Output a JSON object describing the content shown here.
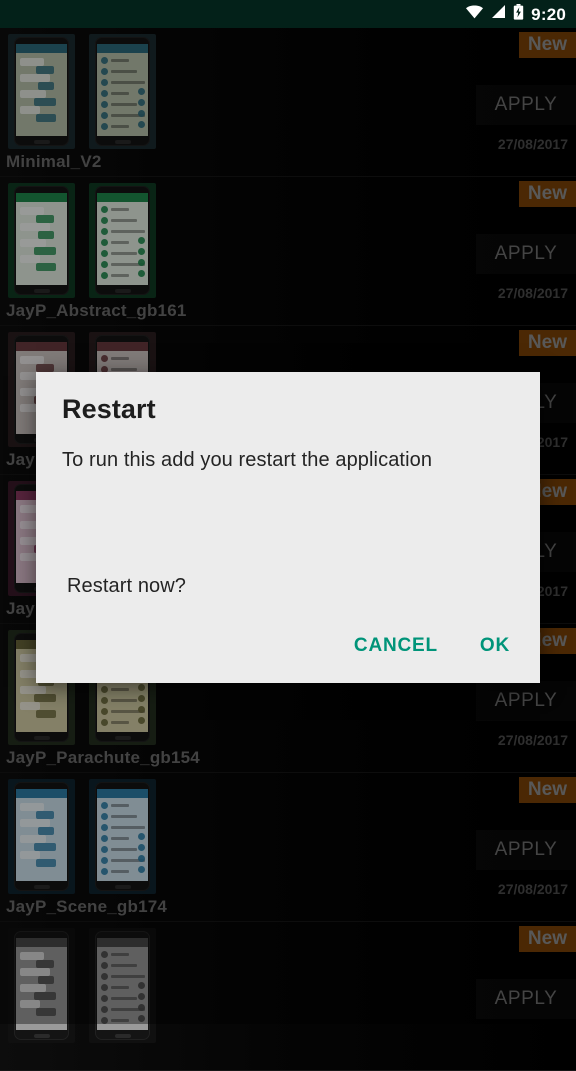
{
  "status_bar": {
    "background_color": "#032119",
    "time": "9:20",
    "icons": [
      "wifi-icon",
      "signal-icon",
      "battery-charging-icon"
    ]
  },
  "theme_list": {
    "apply_label": "APPLY",
    "new_badge_label": "New",
    "rows": [
      {
        "title": "Minimal_V2",
        "date": "27/08/2017",
        "badge": "New",
        "apply": "APPLY",
        "accent": "#2c6b7d",
        "paper": "#b9c2ab",
        "frame": "#1a2a30"
      },
      {
        "title": "JayP_Abstract_gb161",
        "date": "27/08/2017",
        "badge": "New",
        "apply": "APPLY",
        "accent": "#1f8a4c",
        "paper": "#e6efe4",
        "frame": "#0f3a22"
      },
      {
        "title": "Jay",
        "date": "27/08/2017",
        "badge": "New",
        "apply": "APPLY",
        "accent": "#6a3b3f",
        "paper": "#cfc7c4",
        "frame": "#2a1d1f"
      },
      {
        "title": "Jay",
        "date": "27/08/2017",
        "badge": "New",
        "apply": "APPLY",
        "accent": "#8d3a63",
        "paper": "#e3c3d4",
        "frame": "#3a1a2a"
      },
      {
        "title": "JayP_Parachute_gb154",
        "date": "27/08/2017",
        "badge": "New",
        "apply": "APPLY",
        "accent": "#6d6a3c",
        "paper": "#d6cfa6",
        "frame": "#24301f"
      },
      {
        "title": "JayP_Scene_gb174",
        "date": "27/08/2017",
        "badge": "New",
        "apply": "APPLY",
        "accent": "#2e7fa8",
        "paper": "#cfe4ef",
        "frame": "#10242f"
      },
      {
        "title": "",
        "date": "",
        "badge": "New",
        "apply": "APPLY",
        "accent": "#4a4a4a",
        "paper": "#9a9a9a",
        "frame": "#101010"
      }
    ]
  },
  "dialog": {
    "title": "Restart",
    "message": "To run this add you restart the application",
    "question": "Restart now?",
    "cancel_label": "CANCEL",
    "ok_label": "OK",
    "accent_color": "#009479",
    "background_color": "#ececec"
  }
}
